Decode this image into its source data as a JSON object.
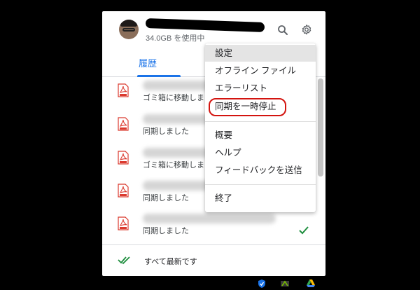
{
  "account": {
    "storage_text": "34.0GB を使用中"
  },
  "tabs": {
    "history": "履歴"
  },
  "files": [
    {
      "status": "ゴミ箱に移動しま",
      "blur_width": 120,
      "checked": false
    },
    {
      "status": "同期しました",
      "blur_width": 110,
      "checked": false
    },
    {
      "status": "ゴミ箱に移動しま",
      "blur_width": 140,
      "checked": false
    },
    {
      "status": "同期しました",
      "blur_width": 100,
      "checked": false
    },
    {
      "status": "同期しました",
      "blur_width": 190,
      "checked": true
    }
  ],
  "footer": {
    "status": "すべて最新です"
  },
  "menu": {
    "items": [
      {
        "label": "設定",
        "name": "menu-item-settings",
        "active": true
      },
      {
        "label": "オフライン ファイル",
        "name": "menu-item-offline-files",
        "active": false
      },
      {
        "label": "エラーリスト",
        "name": "menu-item-error-list",
        "active": false
      },
      {
        "label": "同期を一時停止",
        "name": "menu-item-pause-sync",
        "active": false
      },
      {
        "label": "概要",
        "name": "menu-item-about",
        "active": false
      },
      {
        "label": "ヘルプ",
        "name": "menu-item-help",
        "active": false
      },
      {
        "label": "フィードバックを送信",
        "name": "menu-item-send-feedback",
        "active": false
      },
      {
        "label": "終了",
        "name": "menu-item-quit",
        "active": false
      }
    ]
  },
  "icons": {
    "search": "search-icon",
    "settings": "gear-icon",
    "file": "pdf-file-icon",
    "synced": "check-icon",
    "all_synced": "double-check-icon"
  },
  "colors": {
    "accent": "#1a73e8",
    "pdf_red": "#db3a2f",
    "check_green": "#1e8e3e",
    "highlight": "#d3140f"
  }
}
